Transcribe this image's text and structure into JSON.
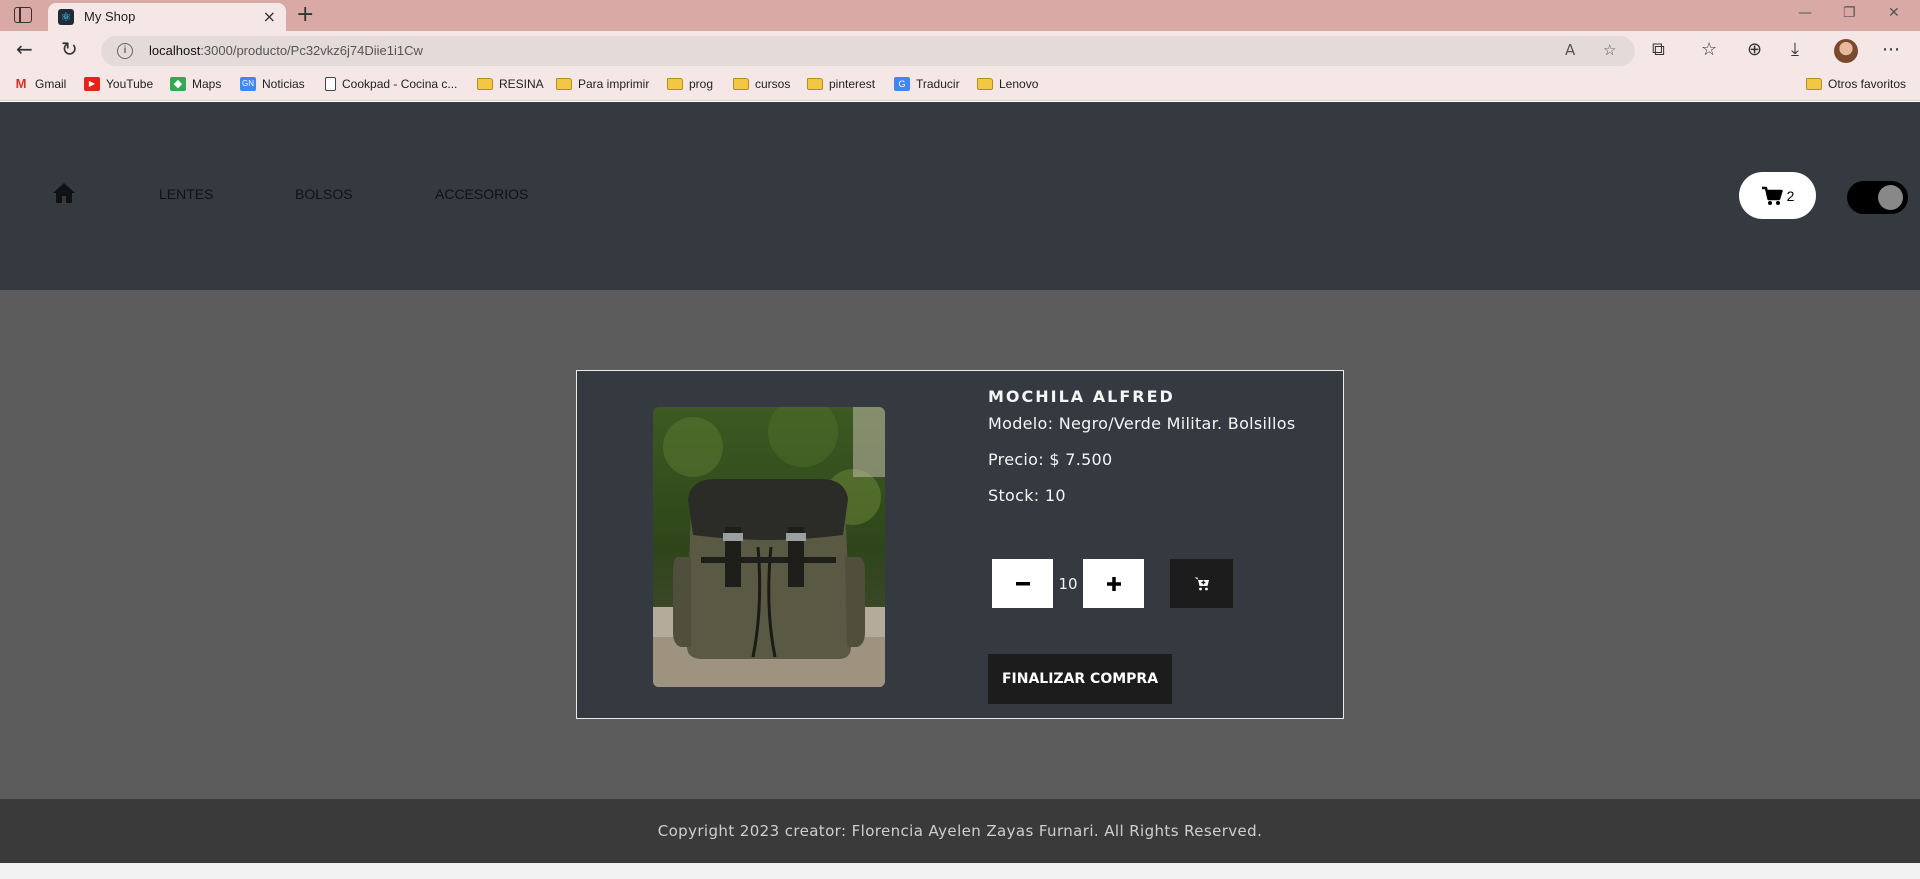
{
  "browser": {
    "tab_title": "My Shop",
    "url_host": "localhost",
    "url_path": ":3000/producto/Pc32vkz6j74Diie1i1Cw",
    "bookmarks": [
      {
        "label": "Gmail",
        "icon": "gmail-icon"
      },
      {
        "label": "YouTube",
        "icon": "youtube-icon"
      },
      {
        "label": "Maps",
        "icon": "maps-icon"
      },
      {
        "label": "Noticias",
        "icon": "news-icon"
      },
      {
        "label": "Cookpad - Cocina c...",
        "icon": "page-icon"
      },
      {
        "label": "RESINA",
        "icon": "folder-icon"
      },
      {
        "label": "Para imprimir",
        "icon": "folder-icon"
      },
      {
        "label": "prog",
        "icon": "folder-icon"
      },
      {
        "label": "cursos",
        "icon": "folder-icon"
      },
      {
        "label": "pinterest",
        "icon": "folder-icon"
      },
      {
        "label": "Traducir",
        "icon": "translate-icon"
      },
      {
        "label": "Lenovo",
        "icon": "folder-icon"
      }
    ],
    "other_bookmarks": "Otros favoritos"
  },
  "header": {
    "nav": [
      "LENTES",
      "BOLSOS",
      "ACCESORIOS"
    ],
    "cart_count": "2"
  },
  "product": {
    "title": "MOCHILA ALFRED",
    "model": "Modelo: Negro/Verde Militar. Bolsillos",
    "price": "Precio: $ 7.500",
    "stock": "Stock: 10",
    "quantity": "10",
    "checkout_label": "FINALIZAR COMPRA"
  },
  "footer": {
    "text": "Copyright 2023 creator: Florencia Ayelen Zayas Furnari. All Rights Reserved."
  },
  "colors": {
    "header_bg": "#343a40",
    "main_bg": "#5c5c5c",
    "footer_bg": "#3a3a3a",
    "browser_tabbar": "#d9a9a6"
  }
}
